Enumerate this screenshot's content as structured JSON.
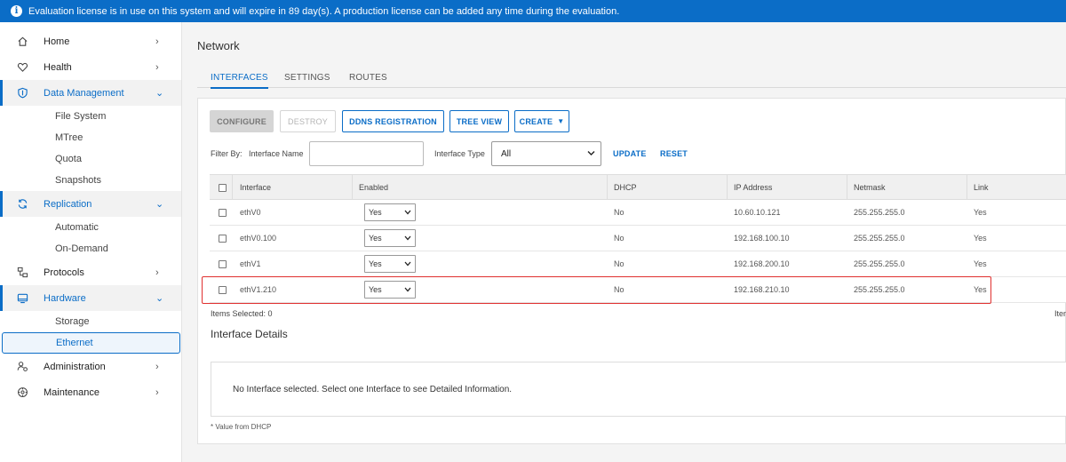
{
  "banner": {
    "icon": "info-icon",
    "text": "Evaluation license is in use on this system and will expire in 89 day(s). A production license can be added any time during the evaluation."
  },
  "sidebar": {
    "items": [
      {
        "label": "Home",
        "icon": "home-icon",
        "chevron": "›"
      },
      {
        "label": "Health",
        "icon": "heart-icon",
        "chevron": "›"
      },
      {
        "label": "Data Management",
        "icon": "shield-icon",
        "chevron": "⌄",
        "subitems": [
          "File System",
          "MTree",
          "Quota",
          "Snapshots"
        ]
      },
      {
        "label": "Replication",
        "icon": "sync-icon",
        "chevron": "⌄",
        "subitems": [
          "Automatic",
          "On-Demand"
        ]
      },
      {
        "label": "Protocols",
        "icon": "protocols-icon",
        "chevron": "›"
      },
      {
        "label": "Hardware",
        "icon": "hardware-icon",
        "chevron": "⌄",
        "subitems": [
          "Storage",
          "Ethernet"
        ]
      },
      {
        "label": "Administration",
        "icon": "admin-icon",
        "chevron": "›"
      },
      {
        "label": "Maintenance",
        "icon": "maintenance-icon",
        "chevron": "›"
      }
    ],
    "selected": "Ethernet"
  },
  "main": {
    "title": "Network",
    "tabs": [
      "INTERFACES",
      "SETTINGS",
      "ROUTES"
    ],
    "active_tab": "INTERFACES",
    "toolbar": {
      "configure": "CONFIGURE",
      "destroy": "DESTROY",
      "ddns": "DDNS REGISTRATION",
      "tree_view": "TREE VIEW",
      "create": "CREATE"
    },
    "filter": {
      "filter_by": "Filter By:",
      "interface_name_label": "Interface Name",
      "interface_name_value": "",
      "interface_type_label": "Interface Type",
      "interface_type_value": "All",
      "update": "UPDATE",
      "reset": "RESET"
    },
    "table": {
      "columns": [
        "Interface",
        "Enabled",
        "DHCP",
        "IP Address",
        "Netmask",
        "Link"
      ],
      "rows": [
        {
          "interface": "ethV0",
          "enabled": "Yes",
          "dhcp": "No",
          "ip": "10.60.10.121",
          "netmask": "255.255.255.0",
          "link": "Yes"
        },
        {
          "interface": "ethV0.100",
          "enabled": "Yes",
          "dhcp": "No",
          "ip": "192.168.100.10",
          "netmask": "255.255.255.0",
          "link": "Yes"
        },
        {
          "interface": "ethV1",
          "enabled": "Yes",
          "dhcp": "No",
          "ip": "192.168.200.10",
          "netmask": "255.255.255.0",
          "link": "Yes"
        },
        {
          "interface": "ethV1.210",
          "enabled": "Yes",
          "dhcp": "No",
          "ip": "192.168.210.10",
          "netmask": "255.255.255.0",
          "link": "Yes"
        }
      ],
      "highlight_color": "#e0302f"
    },
    "items_selected": "Items Selected: 0",
    "items_right": "Item",
    "details": {
      "title": "Interface Details",
      "message": "No Interface selected. Select one Interface to see Detailed Information."
    },
    "footnote": "* Value from DHCP"
  },
  "colors": {
    "accent": "#0b6dc7",
    "banner": "#0b6dc7"
  }
}
